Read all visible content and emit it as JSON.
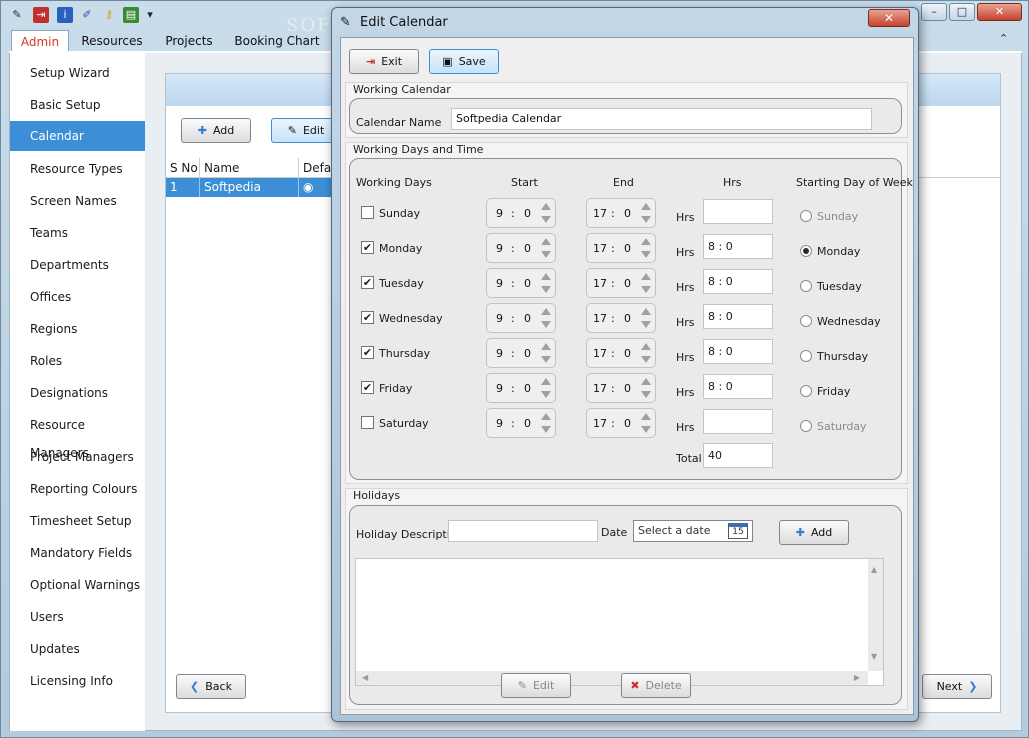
{
  "app": {
    "watermark": "SOFTPEDIA",
    "tabs": [
      "Admin",
      "Resources",
      "Projects",
      "Booking Chart"
    ],
    "active_tab": "Admin",
    "window_controls": [
      "–",
      "□",
      "✕"
    ],
    "ribbon_toggle": "⌃",
    "quick_access_icons": [
      "pin-icon",
      "exit-icon",
      "info-icon",
      "pen-icon",
      "key-icon",
      "chart-icon",
      "dropdown-icon"
    ]
  },
  "nav": {
    "items": [
      "Setup Wizard",
      "Basic Setup",
      "Calendar",
      "Resource Types",
      "Screen Names",
      "Teams",
      "Departments",
      "Offices",
      "Regions",
      "Roles",
      "Designations",
      "Resource Managers",
      "Project Managers",
      "Reporting Colours",
      "Timesheet Setup",
      "Mandatory Fields",
      "Optional Warnings",
      "Users",
      "Updates",
      "Licensing Info"
    ],
    "active": "Calendar"
  },
  "content": {
    "add_label": "Add",
    "edit_label": "Edit",
    "back_label": "Back",
    "next_label": "Next",
    "grid": {
      "columns": [
        "S No",
        "Name",
        "Defau"
      ],
      "rows": [
        {
          "sno": "1",
          "name": "Softpedia Calendar",
          "default": "◉"
        }
      ]
    }
  },
  "dialog": {
    "title": "Edit Calendar",
    "close_label": "✕",
    "exit_label": "Exit",
    "save_label": "Save",
    "working_calendar": {
      "group_label": "Working Calendar",
      "name_label": "Calendar Name",
      "name_value": "Softpedia Calendar"
    },
    "working_days": {
      "group_label": "Working Days and Time",
      "headers": {
        "days": "Working Days",
        "start": "Start",
        "end": "End",
        "hrs": "Hrs",
        "starting_day": "Starting Day of Week"
      },
      "hrs_suffix": "Hrs",
      "total_label": "Total",
      "total_value": "40",
      "starting_day": "Monday",
      "days": [
        {
          "name": "Sunday",
          "checked": false,
          "start_h": "9",
          "start_m": "0",
          "end_h": "17",
          "end_m": "0",
          "hrs": ""
        },
        {
          "name": "Monday",
          "checked": true,
          "start_h": "9",
          "start_m": "0",
          "end_h": "17",
          "end_m": "0",
          "hrs": "8 : 0"
        },
        {
          "name": "Tuesday",
          "checked": true,
          "start_h": "9",
          "start_m": "0",
          "end_h": "17",
          "end_m": "0",
          "hrs": "8 : 0"
        },
        {
          "name": "Wednesday",
          "checked": true,
          "start_h": "9",
          "start_m": "0",
          "end_h": "17",
          "end_m": "0",
          "hrs": "8 : 0"
        },
        {
          "name": "Thursday",
          "checked": true,
          "start_h": "9",
          "start_m": "0",
          "end_h": "17",
          "end_m": "0",
          "hrs": "8 : 0"
        },
        {
          "name": "Friday",
          "checked": true,
          "start_h": "9",
          "start_m": "0",
          "end_h": "17",
          "end_m": "0",
          "hrs": "8 : 0"
        },
        {
          "name": "Saturday",
          "checked": false,
          "start_h": "9",
          "start_m": "0",
          "end_h": "17",
          "end_m": "0",
          "hrs": ""
        }
      ],
      "time_separator": ":"
    },
    "holidays": {
      "group_label": "Holidays",
      "description_label": "Holiday Description",
      "description_value": "",
      "date_label": "Date",
      "date_placeholder": "Select a date",
      "calendar_icon_day": "15",
      "add_label": "Add",
      "edit_label": "Edit",
      "delete_label": "Delete"
    }
  },
  "colors": {
    "selection": "#3c8fd6",
    "active_tab_text": "#d03a2a",
    "close_button": "#c4442c"
  }
}
